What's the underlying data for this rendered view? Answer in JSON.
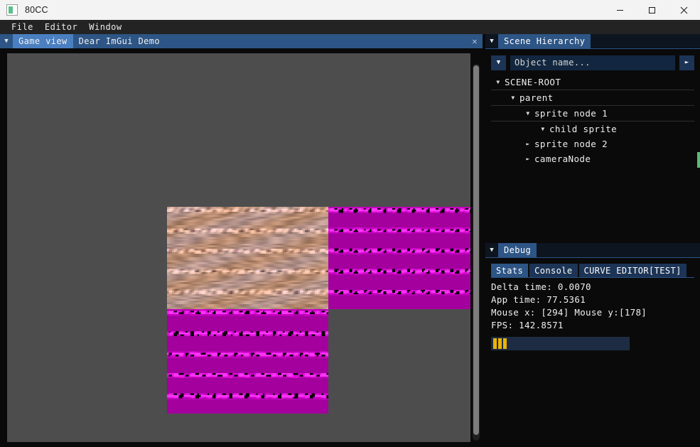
{
  "window": {
    "title": "80CC",
    "icon": "app-icon",
    "controls": [
      {
        "name": "minimize",
        "glyph": "minimize-icon"
      },
      {
        "name": "maximize",
        "glyph": "maximize-icon"
      },
      {
        "name": "close",
        "glyph": "close-icon"
      }
    ]
  },
  "menubar": {
    "items": [
      {
        "label": "File"
      },
      {
        "label": "Editor"
      },
      {
        "label": "Window"
      }
    ]
  },
  "game_dock": {
    "collapse_icon": "collapse-triangle-icon",
    "close_icon": "close-icon",
    "tabs": [
      {
        "label": "Game view",
        "active": true
      },
      {
        "label": "Dear ImGui Demo",
        "active": false
      }
    ],
    "canvas": {
      "background_color": "#4d4d4d",
      "sprites": [
        {
          "name": "sprite-node-1",
          "kind": "skin-texture",
          "base_color": "#c0a08c"
        },
        {
          "name": "sprite-node-2",
          "kind": "magenta-texture",
          "base_color": "#a3009d"
        },
        {
          "name": "child-sprite",
          "kind": "magenta-texture",
          "base_color": "#a3009d"
        }
      ]
    },
    "scrollbar": {
      "name": "vertical-scrollbar",
      "color": "#7d7d7d"
    }
  },
  "hierarchy_panel": {
    "collapse_icon": "collapse-triangle-icon",
    "tab_label": "Scene Hierarchy",
    "filter_dropdown_icon": "chevron-down-icon",
    "search": {
      "placeholder": "Object name...",
      "value": ""
    },
    "submit_icon": "play-arrow-icon",
    "tree": [
      {
        "label": "SCENE-ROOT",
        "depth": 0,
        "arrow": "open"
      },
      {
        "label": "parent",
        "depth": 1,
        "arrow": "open"
      },
      {
        "label": "sprite node 1",
        "depth": 2,
        "arrow": "open"
      },
      {
        "label": "child sprite",
        "depth": 3,
        "arrow": "open"
      },
      {
        "label": "sprite node 2",
        "depth": 2,
        "arrow": "closed"
      },
      {
        "label": "cameraNode",
        "depth": 2,
        "arrow": "closed"
      }
    ]
  },
  "debug_panel": {
    "collapse_icon": "collapse-triangle-icon",
    "tab_label": "Debug",
    "subtabs": [
      {
        "label": "Stats",
        "active": true
      },
      {
        "label": "Console",
        "active": false
      },
      {
        "label": "CURVE EDITOR[TEST]",
        "active": false
      }
    ],
    "stats": [
      {
        "name": "delta-time",
        "text": "Delta time: 0.0070"
      },
      {
        "name": "app-time",
        "text": "App time: 77.5361"
      },
      {
        "name": "mouse-pos",
        "text": "Mouse x: [294] Mouse y:[178]"
      },
      {
        "name": "fps",
        "text": "FPS: 142.8571"
      }
    ],
    "histogram": {
      "name": "frame-time-histogram",
      "bar_color": "#eab308",
      "background_color": "#1d2c42",
      "values": [
        15,
        15,
        15
      ]
    }
  },
  "theme": {
    "accent": "#4a7fc1",
    "tab_inactive": "#2d5585",
    "panel_bg": "#0a0a0a",
    "titlebar_bg": "#f3f3f3",
    "menubar_bg": "#232323"
  }
}
